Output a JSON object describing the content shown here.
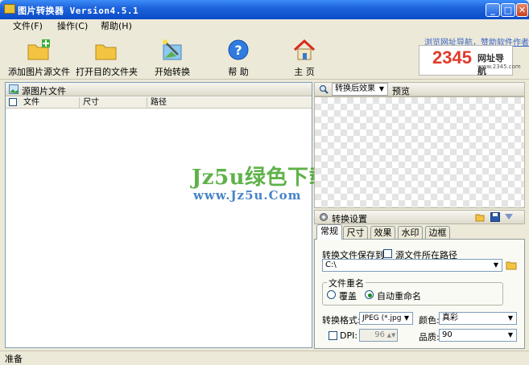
{
  "window": {
    "title": "图片转换器 Version4.5.1",
    "minimize": "_",
    "maximize": "□",
    "close": "✕"
  },
  "menu": [
    {
      "label": "文件(F)"
    },
    {
      "label": "操作(C)"
    },
    {
      "label": "帮助(H)"
    }
  ],
  "toolbar": {
    "add_source": "添加图片源文件",
    "open_target": "打开目的文件夹",
    "start_convert": "开始转换",
    "help": "帮 助",
    "home": "主 页"
  },
  "ad": {
    "link_text": "浏览网址导航，赞助软件作者",
    "logo_number": "2345",
    "logo_text": "网址导航",
    "logo_url": "www.2345.com"
  },
  "source_panel": {
    "title": "源图片文件",
    "columns": [
      "文件",
      "尺寸",
      "路径"
    ]
  },
  "preview": {
    "mode_select": "转换后效果",
    "preview_button": "预览"
  },
  "settings": {
    "title": "转换设置",
    "tabs": [
      "常规",
      "尺寸",
      "效果",
      "水印",
      "边框"
    ],
    "save_to_label": "转换文件保存到:",
    "source_path_checkbox": "源文件所在路径",
    "save_path": "C:\\",
    "rename_group": "文件重名",
    "overwrite_option": "覆盖",
    "auto_rename_option": "自动重命名",
    "format_label": "转换格式:",
    "format_value": "JPEG (*.jpg",
    "color_label": "颜色:",
    "color_value": "真彩",
    "dpi_label": "DPI:",
    "dpi_value": "96",
    "quality_label": "品质:",
    "quality_value": "90"
  },
  "status": {
    "text": "准备"
  },
  "watermark": {
    "title": "Jz5u绿色下载",
    "url": "www.Jz5u.Com"
  }
}
